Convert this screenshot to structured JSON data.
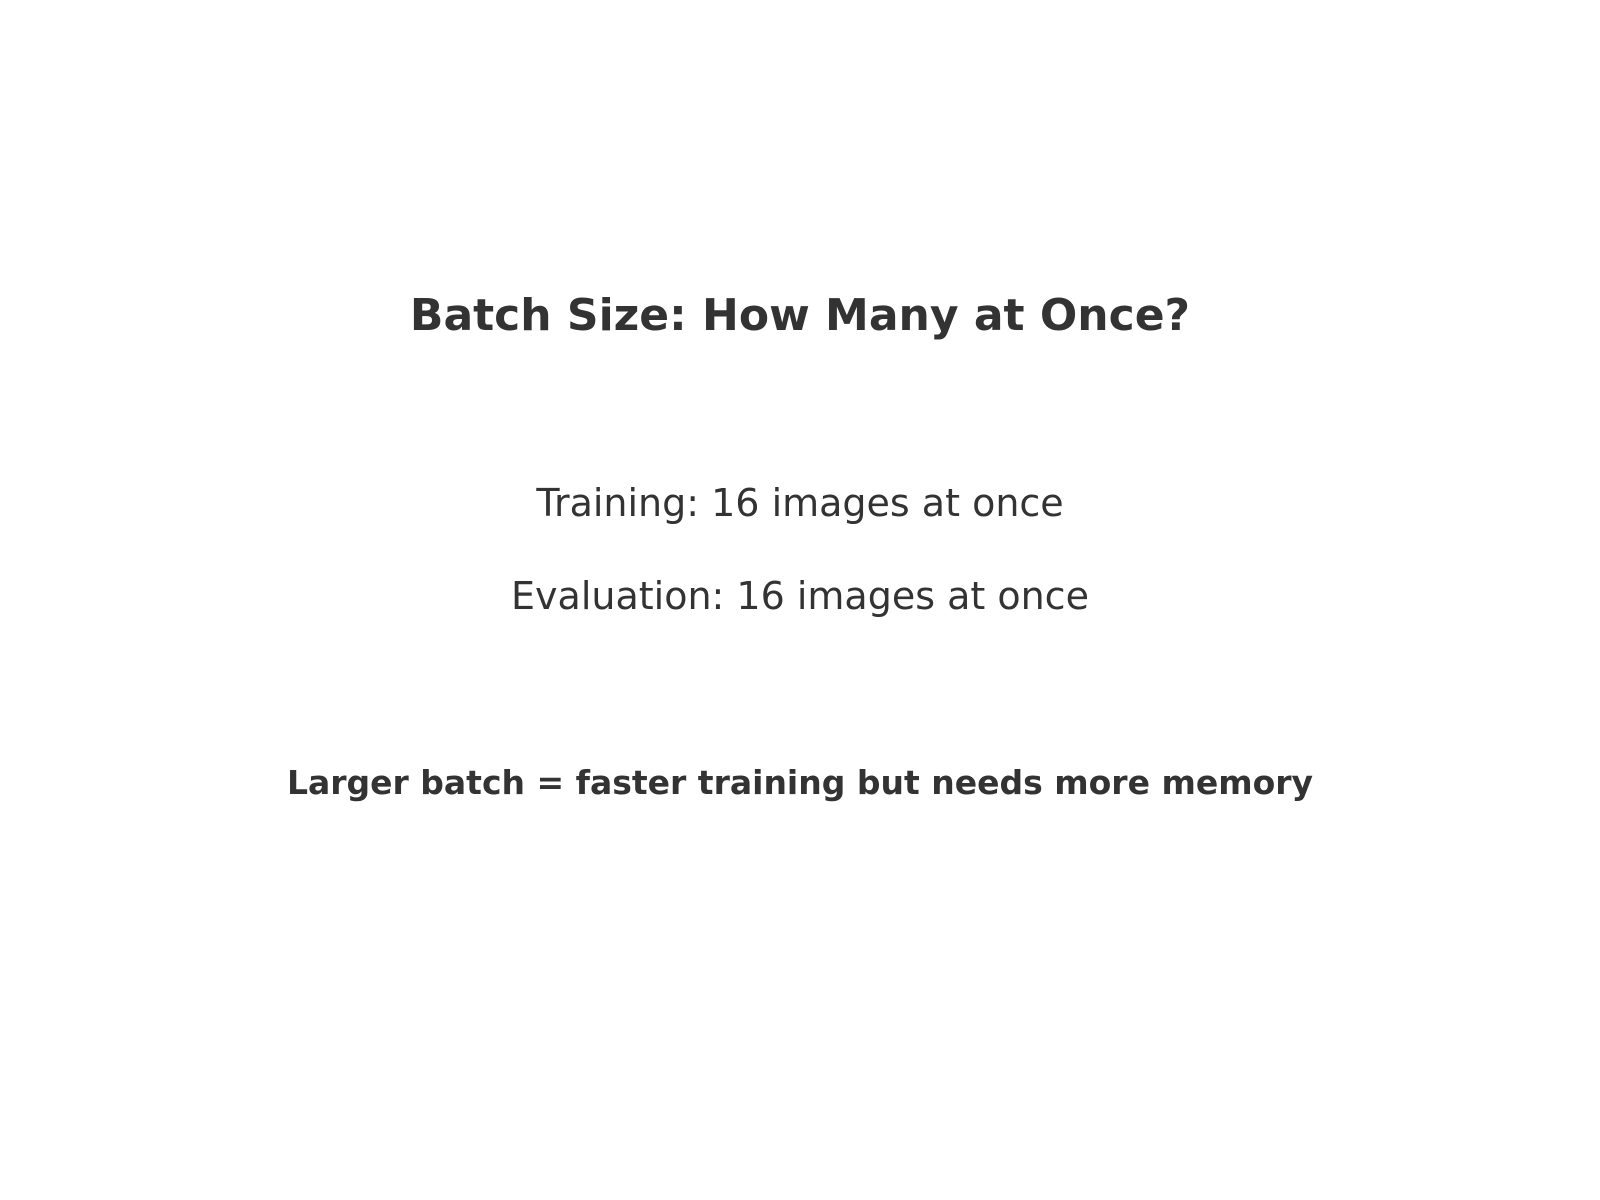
{
  "slide": {
    "title": "Batch Size: How Many at Once?",
    "training_line": "Training: 16 images at once",
    "evaluation_line": "Evaluation: 16 images at once",
    "note": "Larger batch = faster training but needs more memory"
  },
  "colors": {
    "text": "#333333",
    "background": "#ffffff"
  }
}
